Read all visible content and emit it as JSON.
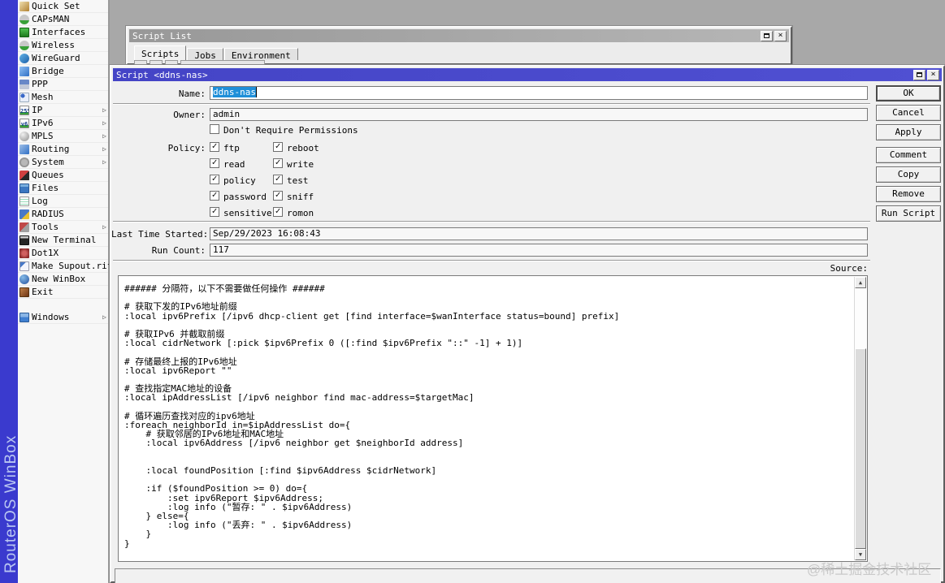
{
  "brand": {
    "vertical_text": "RouterOS WinBox"
  },
  "watermark": {
    "text": "@稀土掘金技术社区"
  },
  "colors": {
    "brand_strip": "#3a3ace",
    "desktop": "#a8a8a8",
    "titlebar_active": "#4747cd",
    "titlebar_inactive": "#a3a3a3",
    "selection": "#1f8fd8",
    "sidebar_bg": "#f7f7f7"
  },
  "sidebar": {
    "items": [
      {
        "label": "Quick Set",
        "icon": "magic-wand-icon",
        "submenu": false
      },
      {
        "label": "CAPsMAN",
        "icon": "antenna-icon",
        "submenu": false
      },
      {
        "label": "Interfaces",
        "icon": "network-card-icon",
        "submenu": false
      },
      {
        "label": "Wireless",
        "icon": "antenna-icon",
        "submenu": false
      },
      {
        "label": "WireGuard",
        "icon": "wireguard-icon",
        "submenu": false
      },
      {
        "label": "Bridge",
        "icon": "bridge-arrows-icon",
        "submenu": false
      },
      {
        "label": "PPP",
        "icon": "ppp-cable-icon",
        "submenu": false
      },
      {
        "label": "Mesh",
        "icon": "mesh-nodes-icon",
        "submenu": false
      },
      {
        "label": "IP",
        "icon": "ip-255-icon",
        "submenu": true
      },
      {
        "label": "IPv6",
        "icon": "ipv6-icon",
        "submenu": true
      },
      {
        "label": "MPLS",
        "icon": "globe-icon",
        "submenu": true
      },
      {
        "label": "Routing",
        "icon": "routing-arrows-icon",
        "submenu": true
      },
      {
        "label": "System",
        "icon": "gear-icon",
        "submenu": true
      },
      {
        "label": "Queues",
        "icon": "gauge-icon",
        "submenu": false
      },
      {
        "label": "Files",
        "icon": "folder-icon",
        "submenu": false
      },
      {
        "label": "Log",
        "icon": "log-list-icon",
        "submenu": false
      },
      {
        "label": "RADIUS",
        "icon": "user-key-icon",
        "submenu": false
      },
      {
        "label": "Tools",
        "icon": "wrench-icon",
        "submenu": true
      },
      {
        "label": "New Terminal",
        "icon": "terminal-icon",
        "submenu": false
      },
      {
        "label": "Dot1X",
        "icon": "dot1x-icon",
        "submenu": false
      },
      {
        "label": "Make Supout.rif",
        "icon": "document-icon",
        "submenu": false
      },
      {
        "label": "New WinBox",
        "icon": "winbox-globe-icon",
        "submenu": false
      },
      {
        "label": "Exit",
        "icon": "exit-door-icon",
        "submenu": false
      },
      {
        "label": "Windows",
        "icon": "window-icon",
        "submenu": true
      }
    ],
    "ip_icon_text": "255",
    "ipv6_icon_text": "v6"
  },
  "script_list": {
    "title": "Script List",
    "tabs": [
      {
        "label": "Scripts"
      },
      {
        "label": "Jobs"
      },
      {
        "label": "Environment"
      }
    ],
    "active_tab": "Scripts",
    "close_glyph": "×"
  },
  "dialog": {
    "title": "Script <ddns-nas>",
    "close_glyph": "×",
    "name": {
      "label": "Name:",
      "value": "ddns-nas"
    },
    "owner": {
      "label": "Owner:",
      "value": "admin"
    },
    "dont_require": {
      "label": "Don't Require Permissions",
      "checked": false
    },
    "policy": {
      "label": "Policy:",
      "options": [
        {
          "label": "ftp",
          "checked": true
        },
        {
          "label": "reboot",
          "checked": true
        },
        {
          "label": "read",
          "checked": true
        },
        {
          "label": "write",
          "checked": true
        },
        {
          "label": "policy",
          "checked": true
        },
        {
          "label": "test",
          "checked": true
        },
        {
          "label": "password",
          "checked": true
        },
        {
          "label": "sniff",
          "checked": true
        },
        {
          "label": "sensitive",
          "checked": true
        },
        {
          "label": "romon",
          "checked": true
        }
      ]
    },
    "last_time": {
      "label": "Last Time Started:",
      "value": "Sep/29/2023 16:08:43"
    },
    "run_count": {
      "label": "Run Count:",
      "value": "117"
    },
    "source": {
      "label": "Source:",
      "code": "###### 分隔符，以下不需要做任何操作 ######\n\n# 获取下发的IPv6地址前缀\n:local ipv6Prefix [/ipv6 dhcp-client get [find interface=$wanInterface status=bound] prefix]\n\n# 获取IPv6 并截取前缀\n:local cidrNetwork [:pick $ipv6Prefix 0 ([:find $ipv6Prefix \"::\" -1] + 1)]\n\n# 存储最终上报的IPv6地址\n:local ipv6Report \"\"\n\n# 查找指定MAC地址的设备\n:local ipAddressList [/ipv6 neighbor find mac-address=$targetMac]\n\n# 循环遍历查找对应的ipv6地址\n:foreach neighborId in=$ipAddressList do={\n    # 获取邻居的IPv6地址和MAC地址\n    :local ipv6Address [/ipv6 neighbor get $neighborId address]\n\n\n    :local foundPosition [:find $ipv6Address $cidrNetwork]\n\n    :if ($foundPosition >= 0) do={\n        :set ipv6Report $ipv6Address;\n        :log info (\"暂存: \" . $ipv6Address)\n    } else={\n        :log info (\"丢弃: \" . $ipv6Address)\n    }\n}"
    },
    "buttons": [
      {
        "label": "OK"
      },
      {
        "label": "Cancel"
      },
      {
        "label": "Apply"
      },
      {
        "label": "Comment"
      },
      {
        "label": "Copy"
      },
      {
        "label": "Remove"
      },
      {
        "label": "Run Script"
      }
    ]
  }
}
